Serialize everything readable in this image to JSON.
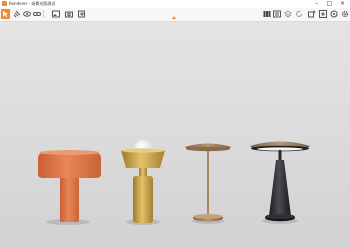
{
  "window": {
    "title": "Renderer - 场景光照测试"
  },
  "toolbar": {
    "left_tools": [
      {
        "icon": "select-icon",
        "active": true
      },
      {
        "icon": "link-icon"
      },
      {
        "icon": "view-icon"
      },
      {
        "icon": "chain-icon"
      },
      {
        "icon": "image-icon"
      },
      {
        "icon": "camera-icon"
      },
      {
        "icon": "render-icon"
      }
    ],
    "right_tools": [
      {
        "icon": "library-icon"
      },
      {
        "icon": "render-queue-icon"
      },
      {
        "icon": "layers-icon"
      },
      {
        "icon": "rotate-icon"
      },
      {
        "icon": "add-layer-icon"
      },
      {
        "icon": "export-icon"
      },
      {
        "icon": "settings-icon"
      },
      {
        "icon": "gear-icon"
      }
    ]
  },
  "scene": {
    "lamps": [
      "orange-mushroom-lamp",
      "brass-globe-lamp",
      "bronze-disc-lamp",
      "black-cone-lamp"
    ]
  },
  "colors": {
    "accent": "#f28a2e",
    "orange_lamp": "#e0784a",
    "brass": "#c9a043",
    "bronze": "#9a7a58",
    "black": "#2a2b2e"
  }
}
